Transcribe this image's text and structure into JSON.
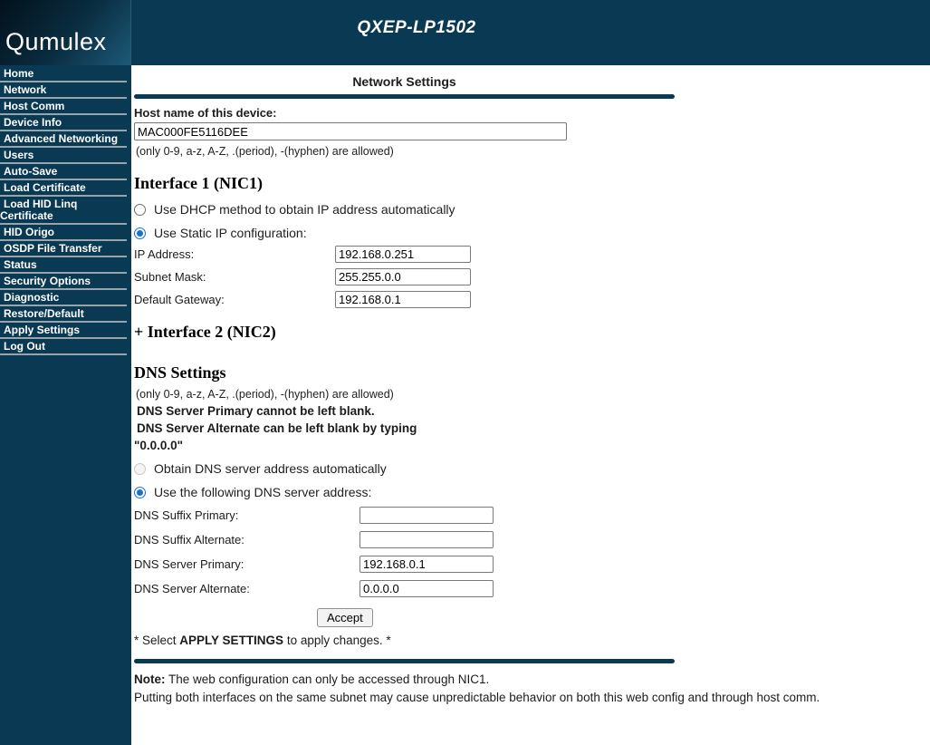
{
  "header": {
    "logo": "Qumulex",
    "title": "QXEP-LP1502"
  },
  "sidebar": {
    "items": [
      "Home",
      "Network",
      "Host Comm",
      "Device Info",
      "Advanced Networking",
      "Users",
      "Auto-Save",
      "Load Certificate",
      "Load HID Linq Certificate",
      "HID Origo",
      "OSDP File Transfer",
      "Status",
      "Security Options",
      "Diagnostic",
      "Restore/Default",
      "Apply Settings",
      "Log Out"
    ]
  },
  "main": {
    "title": "Network Settings",
    "hostname": {
      "label": "Host name of this device:",
      "value": "MAC000FE5116DEE",
      "note": "(only 0-9, a-z, A-Z, .(period), -(hyphen) are allowed)"
    },
    "nic1": {
      "heading": "Interface 1 (NIC1)",
      "radio_dhcp": "Use DHCP method to obtain IP address automatically",
      "radio_static": "Use Static IP configuration:",
      "fields": [
        {
          "label": "IP Address:",
          "value": "192.168.0.251"
        },
        {
          "label": "Subnet Mask:",
          "value": "255.255.0.0"
        },
        {
          "label": "Default Gateway:",
          "value": "192.168.0.1"
        }
      ]
    },
    "nic2": {
      "heading": "+ Interface 2 (NIC2)"
    },
    "dns": {
      "heading": "DNS Settings",
      "note": "(only 0-9, a-z, A-Z, .(period), -(hyphen) are allowed)",
      "warning_primary": "DNS Server Primary cannot be left blank.",
      "warning_alt_line1": "DNS Server Alternate can be left blank by typing",
      "warning_alt_line2": "\"0.0.0.0\"",
      "radio_auto": "Obtain DNS server address automatically",
      "radio_manual": "Use the following DNS server address:",
      "fields": [
        {
          "label": "DNS Suffix Primary:",
          "value": ""
        },
        {
          "label": "DNS Suffix Alternate:",
          "value": ""
        },
        {
          "label": "DNS Server Primary:",
          "value": "192.168.0.1"
        },
        {
          "label": "DNS Server Alternate:",
          "value": "0.0.0.0"
        }
      ]
    },
    "accept_label": "Accept",
    "apply_note": {
      "prefix": "* Select ",
      "bold": "APPLY SETTINGS",
      "suffix": " to apply changes. *"
    },
    "footer": {
      "note_label": "Note:",
      "note_text": " The web configuration can only be accessed through NIC1.",
      "line2": "Putting both interfaces on the same subnet may cause unpredictable behavior on both this web config and through host comm."
    }
  },
  "colors": {
    "navy": "#0a3a53",
    "radio_blue": "#1a6fd4",
    "separator": "#98a4ac"
  }
}
